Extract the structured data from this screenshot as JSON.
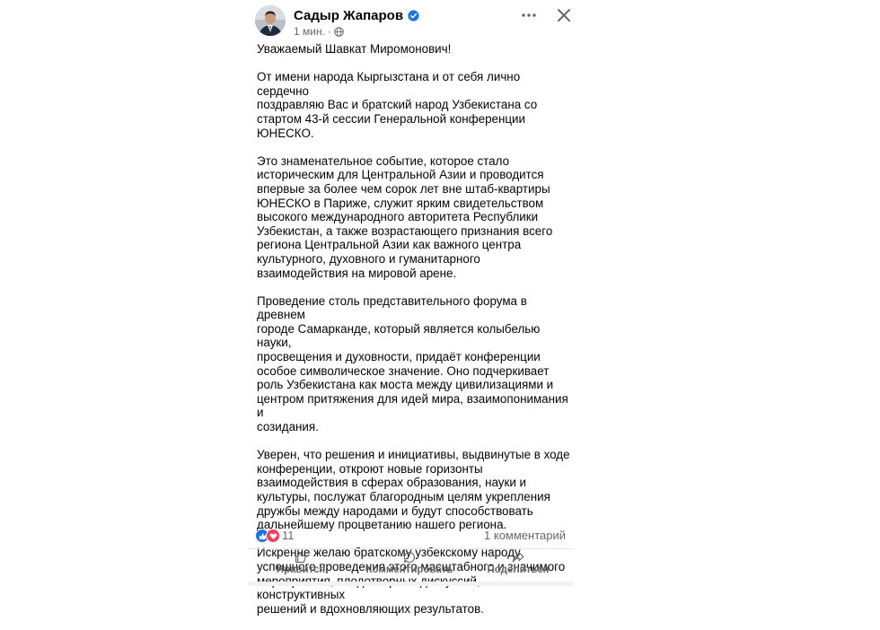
{
  "post": {
    "author": "Садыр Жапаров",
    "time": "1 мин.",
    "paragraphs": [
      "Уважаемый Шавкат Миромонович!",
      "От имени народа Кыргызстана и от себя лично сердечно\nпоздравляю Вас и братский народ Узбекистана со\nстартом 43-й сессии Генеральной конференции\nЮНЕСКО.",
      "Это знаменательное событие, которое стало\nисторическим для Центральной Азии и проводится\nвпервые за более чем сорок лет вне штаб-квартиры\nЮНЕСКО в Париже, служит ярким свидетельством\nвысокого международного авторитета Республики\nУзбекистан, а также возрастающего признания всего\nрегиона Центральной Азии как важного центра\nкультурного, духовного и гуманитарного\nвзаимодействия на мировой арене.",
      "Проведение столь представительного форума в древнем\nгороде Самарканде, который является колыбелью науки,\nпросвещения и духовности, придаёт конференции\nособое символическое значение. Оно подчеркивает\nроль Узбекистана как моста между цивилизациями и\nцентром притяжения для идей мира, взаимопонимания и\nсозидания.",
      "Уверен, что решения и инициативы, выдвинутые в ходе\nконференции, откроют новые горизонты\nвзаимодействия в сферах образования, науки и\nкультуры, послужат благородным целям укрепления\nдружбы между народами и будут способствовать\nдальнейшему процветанию нашего региона.",
      "Искренне желаю братскому узбекскому народу\nуспешного проведения этого масштабного и значимого\nмероприятия, плодотворных дискуссий, конструктивных\nрешений и вдохновляющих результатов."
    ],
    "reactions_count": "11",
    "comments_count": "1 комментарий"
  },
  "actions": {
    "like": "Нравится",
    "comment": "Комментировать",
    "share": "Поделиться"
  },
  "colors": {
    "accent": "#1b74e4",
    "love": "#f33e58",
    "secondary_text": "#65676b"
  },
  "icons": [
    "avatar",
    "verified-badge-icon",
    "globe-icon",
    "more-options-icon",
    "close-icon",
    "like-reaction-icon",
    "love-reaction-icon",
    "thumbs-up-icon",
    "comment-icon",
    "share-icon"
  ]
}
